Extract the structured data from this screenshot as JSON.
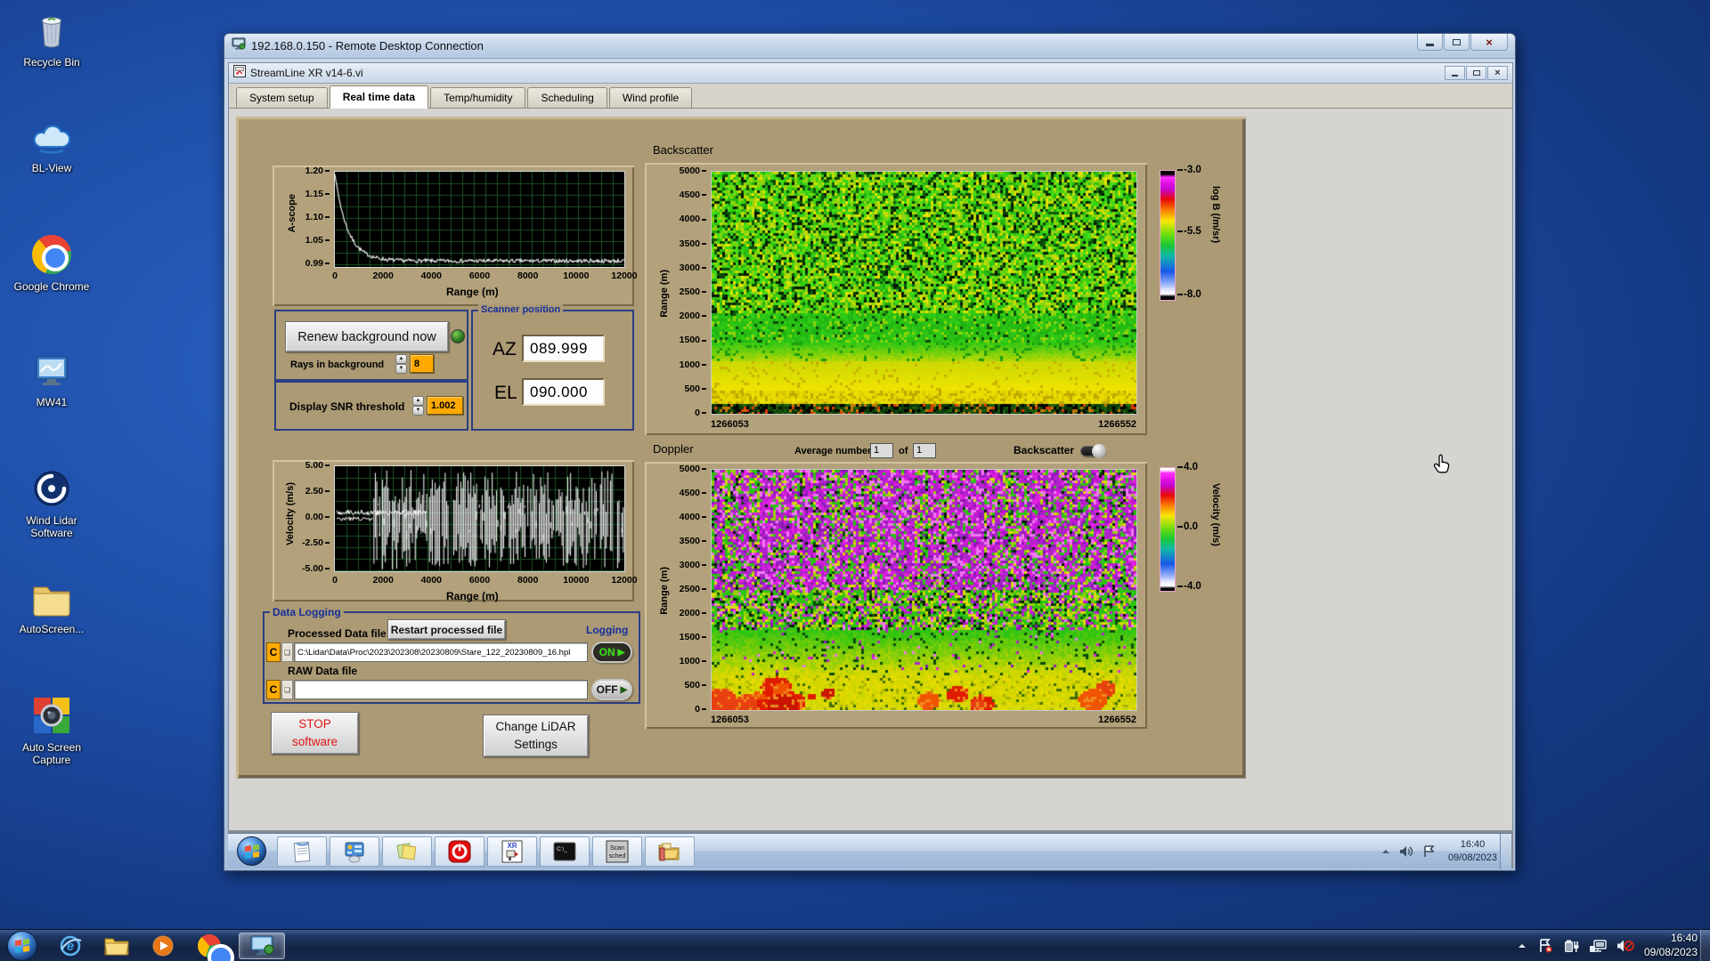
{
  "desktop": {
    "icons": [
      {
        "id": "recycle-bin",
        "label": "Recycle Bin"
      },
      {
        "id": "bl-view",
        "label": "BL-View"
      },
      {
        "id": "google-chrome",
        "label": "Google Chrome"
      },
      {
        "id": "mw41",
        "label": "MW41"
      },
      {
        "id": "wind-lidar",
        "label": "Wind Lidar Software"
      },
      {
        "id": "autoscreen-folder",
        "label": "AutoScreen..."
      },
      {
        "id": "auto-screen-capture",
        "label": "Auto Screen Capture"
      }
    ]
  },
  "rdp": {
    "title": "192.168.0.150 - Remote Desktop Connection"
  },
  "vi": {
    "title": "StreamLine XR v14-6.vi",
    "tabs": [
      {
        "label": "System setup",
        "active": false
      },
      {
        "label": "Real time data",
        "active": true
      },
      {
        "label": "Temp/humidity",
        "active": false
      },
      {
        "label": "Scheduling",
        "active": false
      },
      {
        "label": "Wind profile",
        "active": false
      }
    ]
  },
  "ascope": {
    "ylabel": "A-scope",
    "yticks": [
      "1.20",
      "1.15",
      "1.10",
      "1.05",
      "0.99"
    ],
    "xticks": [
      "0",
      "2000",
      "4000",
      "6000",
      "8000",
      "10000",
      "12000"
    ],
    "xlabel": "Range (m)"
  },
  "velocity_plot": {
    "ylabel": "Velocity (m/s)",
    "yticks": [
      "5.00",
      "2.50",
      "0.00",
      "-2.50",
      "-5.00"
    ],
    "xticks": [
      "0",
      "2000",
      "4000",
      "6000",
      "8000",
      "10000",
      "12000"
    ],
    "xlabel": "Range (m)"
  },
  "background_ctrl": {
    "button": "Renew background now",
    "rays_label": "Rays in background",
    "rays_value": "8",
    "snr_label": "Display SNR threshold",
    "snr_value": "1.002"
  },
  "scanner": {
    "title": "Scanner position",
    "az_label": "AZ",
    "az_value": "089.999",
    "el_label": "EL",
    "el_value": "090.000"
  },
  "backscatter": {
    "title": "Backscatter",
    "ylabel": "Range (m)",
    "yticks": [
      "5000",
      "4500",
      "4000",
      "3500",
      "3000",
      "2500",
      "2000",
      "1500",
      "1000",
      "500",
      "0"
    ],
    "x_start": "1266053",
    "x_end": "1266552",
    "cbar_ticks": [
      "-3.0",
      "-5.5",
      "-8.0"
    ],
    "cbar_label": "log B (/m/sr)"
  },
  "doppler": {
    "title": "Doppler",
    "avg_label": "Average number",
    "avg_value": "1",
    "of_label": "of",
    "of_value": "1",
    "toggle_label": "Backscatter",
    "ylabel": "Range (m)",
    "yticks": [
      "5000",
      "4500",
      "4000",
      "3500",
      "3000",
      "2500",
      "2000",
      "1500",
      "1000",
      "500",
      "0"
    ],
    "x_start": "1266053",
    "x_end": "1266552",
    "cbar_ticks": [
      "4.0",
      "0.0",
      "-4.0"
    ],
    "cbar_label": "Velocity (m/s)"
  },
  "logging": {
    "title": "Data Logging",
    "processed_label": "Processed Data file",
    "restart_button": "Restart processed file",
    "logging_label": "Logging",
    "drive_letter": "C",
    "processed_path": "C:\\Lidar\\Data\\Proc\\2023\\202308\\20230809\\Stare_122_20230809_16.hpl",
    "on_label": "ON",
    "raw_label": "RAW Data file",
    "raw_path": "",
    "off_label": "OFF"
  },
  "actions": {
    "stop_line1": "STOP",
    "stop_line2": "software",
    "change_line1": "Change LiDAR",
    "change_line2": "Settings"
  },
  "remote_taskbar": {
    "icons": [
      "start",
      "notepad",
      "display-settings",
      "sticky-notes",
      "stop-software",
      "streamline-xr",
      "command-prompt",
      "scan-scheduler",
      "file-explorer"
    ],
    "scan_text": "Scan sched",
    "cmd_text": "C:\\_",
    "xr_text": "XR",
    "tray_time": "16:40",
    "tray_date": "09/08/2023"
  },
  "host_taskbar": {
    "icons": [
      "start",
      "internet-explorer",
      "windows-explorer",
      "media-player",
      "chrome",
      "remote-desktop"
    ],
    "tray_time": "16:40",
    "tray_date": "09/08/2023"
  },
  "chart_data": [
    {
      "type": "line",
      "title": "A-scope",
      "xlabel": "Range (m)",
      "ylabel": "A-scope",
      "xlim": [
        0,
        12000
      ],
      "ylim": [
        0.99,
        1.2
      ],
      "grid": true,
      "series": [
        {
          "name": "A-scope",
          "approx_points": [
            [
              0,
              1.2
            ],
            [
              400,
              1.16
            ],
            [
              800,
              1.1
            ],
            [
              1200,
              1.05
            ],
            [
              1800,
              1.02
            ],
            [
              2500,
              1.005
            ],
            [
              4000,
              1.0
            ],
            [
              8000,
              1.0
            ],
            [
              12000,
              1.0
            ]
          ]
        }
      ],
      "note": "white trace decaying exponentially to a ~1.00 noise floor beyond ~2500 m"
    },
    {
      "type": "line",
      "title": "Velocity",
      "xlabel": "Range (m)",
      "ylabel": "Velocity (m/s)",
      "xlim": [
        0,
        12000
      ],
      "ylim": [
        -5,
        5
      ],
      "grid": true,
      "note": "near-zero velocity trace out to ~1500 m, then full-scale random noise spikes spanning -5 to +5 m/s at farther ranges"
    },
    {
      "type": "heatmap",
      "title": "Backscatter",
      "ylabel": "Range (m)",
      "x_range": [
        1266053,
        1266552
      ],
      "y_range": [
        0,
        5000
      ],
      "colorbar": {
        "label": "log B (/m/sr)",
        "ticks": [
          -3.0,
          -5.5,
          -8.0
        ]
      },
      "note": "speckled green noise above ~2000 m, smooth green 700-2000 m, bright yellow aerosol layer near 300-600 m, dark/black lowest gates"
    },
    {
      "type": "heatmap",
      "title": "Doppler",
      "ylabel": "Range (m)",
      "x_range": [
        1266053,
        1266552
      ],
      "y_range": [
        0,
        5000
      ],
      "colorbar": {
        "label": "Velocity (m/s)",
        "ticks": [
          4.0,
          0.0,
          -4.0
        ]
      },
      "note": "magenta/purple vertical noise streaks above ~2500 m, green-yellow valid velocities below, red/orange patches near the surface"
    }
  ]
}
